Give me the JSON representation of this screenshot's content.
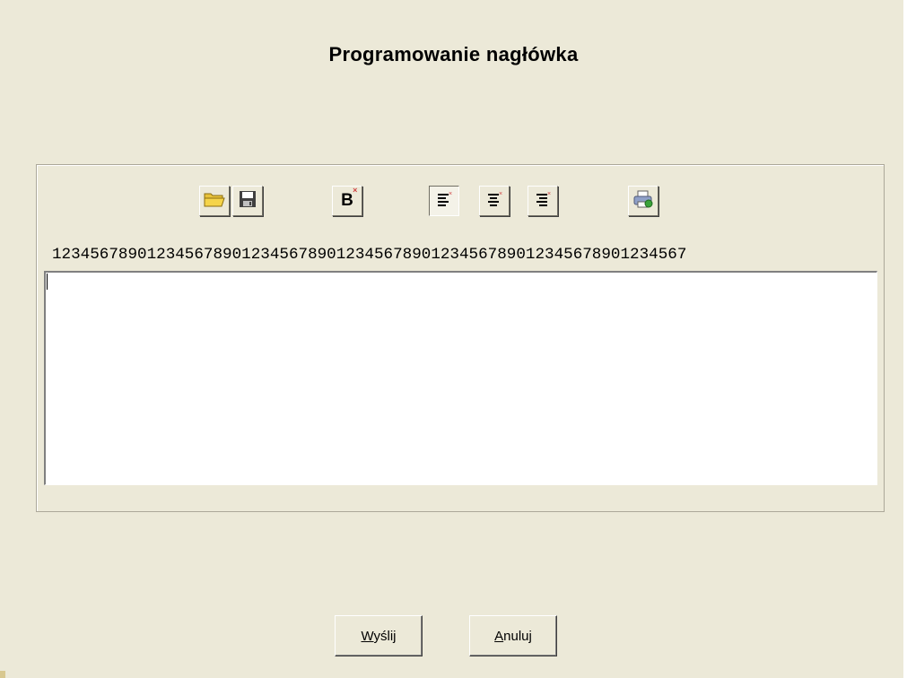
{
  "dialog": {
    "title": "Programowanie nagłówka"
  },
  "toolbar": {
    "buttons": [
      {
        "name": "open",
        "icon": "folder-open-icon"
      },
      {
        "name": "save",
        "icon": "floppy-disk-icon"
      },
      {
        "name": "bold",
        "icon": "bold-icon",
        "label": "B"
      },
      {
        "name": "align-left",
        "icon": "align-left-icon",
        "pressed": true
      },
      {
        "name": "align-center",
        "icon": "align-center-icon",
        "pressed": false
      },
      {
        "name": "align-right",
        "icon": "align-right-icon",
        "pressed": false
      },
      {
        "name": "print",
        "icon": "printer-icon"
      }
    ]
  },
  "ruler": {
    "text": "1234567890123456789012345678901234567890123456789012345678901234567"
  },
  "editor": {
    "value": ""
  },
  "buttons": {
    "send": {
      "mnemonic": "W",
      "rest": "yślij"
    },
    "cancel": {
      "mnemonic": "A",
      "rest": "nuluj"
    }
  },
  "colors": {
    "background": "#ece9d8",
    "folder": "#f5d44a",
    "printer_accent": "#3aa23a"
  }
}
